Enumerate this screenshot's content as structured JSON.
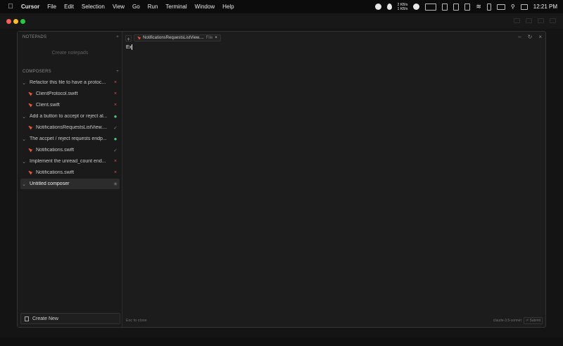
{
  "menubar": {
    "app_name": "Cursor",
    "items": [
      "File",
      "Edit",
      "Selection",
      "View",
      "Go",
      "Run",
      "Terminal",
      "Window",
      "Help"
    ],
    "net_up": "2 KB/s",
    "net_down": "1 KB/s",
    "clock": "12:21 PM"
  },
  "sidebar": {
    "notepads_header": "NOTEPADS",
    "create_notepads": "Create notepads",
    "composers_header": "COMPOSERS",
    "add_icon": "+",
    "rows": [
      {
        "label": "Refactor this file to have a protoc...",
        "mark": "×",
        "type": "group"
      },
      {
        "label": "ClientProtocol.swift",
        "mark": "×",
        "type": "file"
      },
      {
        "label": "Client.swift",
        "mark": "×",
        "type": "file"
      },
      {
        "label": "Add a button to accept or reject al...",
        "mark": "●",
        "type": "group"
      },
      {
        "label": "NotificationsRequestsListView....",
        "mark": "✓",
        "type": "file"
      },
      {
        "label": "The accpet / reject requests endp...",
        "mark": "●",
        "type": "group"
      },
      {
        "label": "Notifications.swift",
        "mark": "✓",
        "type": "file"
      },
      {
        "label": "Implement the unread_count end...",
        "mark": "×",
        "type": "group"
      },
      {
        "label": "Notifications.swift",
        "mark": "×",
        "type": "file"
      },
      {
        "label": "Untitled composer",
        "mark": "✳",
        "type": "group-selected"
      }
    ],
    "create_new": "Create New"
  },
  "main": {
    "tab_plus": "+",
    "chip_label": "NotificationsRequestsListView....",
    "chip_tag": "File",
    "chip_close": "×",
    "input_text": "Ex",
    "footer_left": "Esc to close",
    "model": "claude-3.5-sonnet",
    "submit": "⏎ Submit"
  }
}
